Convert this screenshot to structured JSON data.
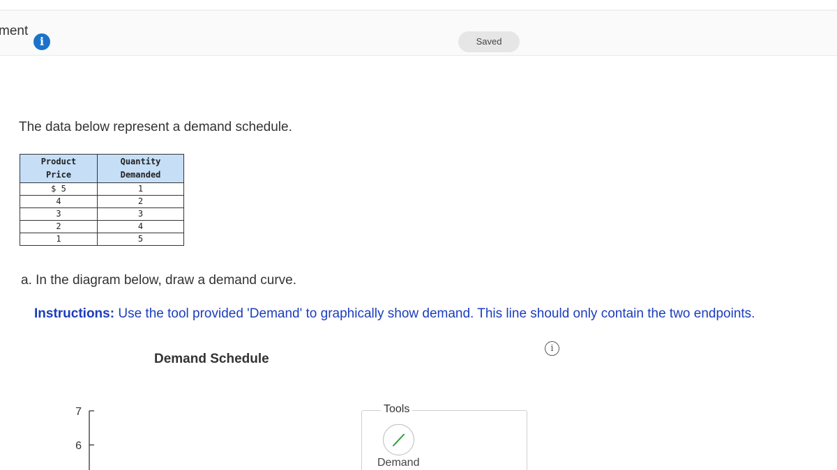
{
  "header": {
    "title": "ment",
    "info_icon": "i",
    "status": "Saved"
  },
  "intro": "The data below represent a demand schedule.",
  "schedule": {
    "headers": [
      [
        "Product",
        "Price"
      ],
      [
        "Quantity",
        "Demanded"
      ]
    ],
    "rows": [
      [
        "$ 5",
        "1"
      ],
      [
        "4",
        "2"
      ],
      [
        "3",
        "3"
      ],
      [
        "2",
        "4"
      ],
      [
        "1",
        "5"
      ]
    ],
    "header_color": "#c6dff7"
  },
  "question": "a. In the diagram below, draw a demand curve.",
  "instructions": {
    "label": "Instructions:",
    "text": "Use the tool provided 'Demand' to graphically show demand. This line should only contain the two endpoints.",
    "color": "#1b3dbb"
  },
  "info_outline_icon": "i",
  "chart": {
    "title": "Demand Schedule",
    "y_ticks": [
      "7",
      "6"
    ]
  },
  "tools": {
    "label": "Tools",
    "items": [
      {
        "name": "Demand",
        "icon": "line-draw-icon",
        "color": "#2e9c3a"
      }
    ]
  }
}
